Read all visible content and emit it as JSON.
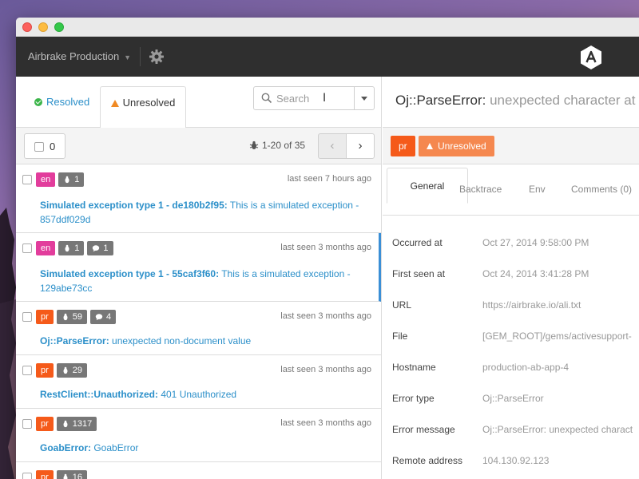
{
  "topbar": {
    "project": "Airbrake Production"
  },
  "tabs": {
    "resolved": "Resolved",
    "unresolved": "Unresolved"
  },
  "search": {
    "placeholder": "Search"
  },
  "toolbar": {
    "selected_count": "0",
    "range": "1-20 of 35"
  },
  "errors": [
    {
      "env": "en",
      "occurrences": "1",
      "comments": "",
      "seen": "last seen 7 hours ago",
      "type": "Simulated exception type 1 - de180b2f95:",
      "message": " This is a simulated exception - 857ddf029d"
    },
    {
      "env": "en",
      "occurrences": "1",
      "comments": "1",
      "seen": "last seen 3 months ago",
      "type": "Simulated exception type 1 - 55caf3f60:",
      "message": " This is a simulated exception - 129abe73cc"
    },
    {
      "env": "pr",
      "occurrences": "59",
      "comments": "4",
      "seen": "last seen 3 months ago",
      "type": "Oj::ParseError:",
      "message": " unexpected non-document value"
    },
    {
      "env": "pr",
      "occurrences": "29",
      "comments": "",
      "seen": "last seen 3 months ago",
      "type": "RestClient::Unauthorized:",
      "message": " 401 Unauthorized"
    },
    {
      "env": "pr",
      "occurrences": "1317",
      "comments": "",
      "seen": "last seen 3 months ago",
      "type": "GoabError:",
      "message": " GoabError"
    },
    {
      "env": "pr",
      "occurrences": "16",
      "comments": "",
      "seen": "",
      "type": "",
      "message": ""
    }
  ],
  "detail": {
    "error_class": "Oj::ParseError:",
    "error_message": " unexpected character at",
    "env": "pr",
    "state": "Unresolved",
    "tabs": [
      "General",
      "Backtrace",
      "Env",
      "Comments (0)"
    ],
    "fields": [
      {
        "key": "Occurred at",
        "value": "Oct 27, 2014 9:58:00 PM"
      },
      {
        "key": "First seen at",
        "value": "Oct 24, 2014 3:41:28 PM"
      },
      {
        "key": "URL",
        "value": "https://airbrake.io/ali.txt"
      },
      {
        "key": "File",
        "value": "[GEM_ROOT]/gems/activesupport-"
      },
      {
        "key": "Hostname",
        "value": "production-ab-app-4"
      },
      {
        "key": "Error type",
        "value": "Oj::ParseError"
      },
      {
        "key": "Error message",
        "value": "Oj::ParseError: unexpected charact"
      },
      {
        "key": "Remote address",
        "value": "104.130.92.123"
      }
    ]
  },
  "colors": {
    "accent": "#2b8fc9",
    "env_en": "#e23d9c",
    "env_pr": "#f55a1a",
    "unresolved": "#f5884f",
    "selected_marker": "#3b8fd6"
  },
  "icons": [
    "gear-icon",
    "airbrake-logo",
    "check-circle-icon",
    "warning-icon",
    "search-icon",
    "chevron-down-icon",
    "bug-icon",
    "comment-icon",
    "chevron-left-icon",
    "chevron-right-icon"
  ]
}
